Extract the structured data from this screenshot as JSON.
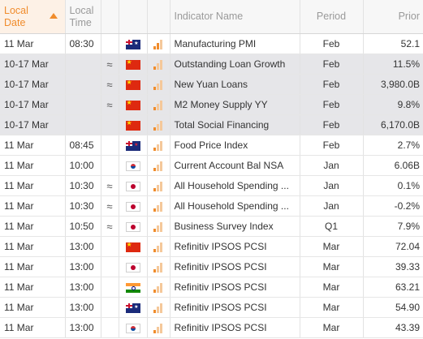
{
  "header": {
    "local_date": "Local Date",
    "local_time": "Local Time",
    "indicator_name": "Indicator Name",
    "period": "Period",
    "prior": "Prior"
  },
  "colors": {
    "accent": "#f08c2c",
    "shaded_row": "#e6e6e9"
  },
  "rows": [
    {
      "date": "11 Mar",
      "time": "08:30",
      "approx": "",
      "flag": "au",
      "importance": 2,
      "name": "Manufacturing PMI",
      "period": "Feb",
      "prior": "52.1",
      "shaded": false
    },
    {
      "date": "10-17 Mar",
      "time": "",
      "approx": "≈",
      "flag": "cn",
      "importance": 1,
      "name": "Outstanding Loan Growth",
      "period": "Feb",
      "prior": "11.5%",
      "shaded": true
    },
    {
      "date": "10-17 Mar",
      "time": "",
      "approx": "≈",
      "flag": "cn",
      "importance": 1,
      "name": "New Yuan Loans",
      "period": "Feb",
      "prior": "3,980.0B",
      "shaded": true
    },
    {
      "date": "10-17 Mar",
      "time": "",
      "approx": "≈",
      "flag": "cn",
      "importance": 1,
      "name": "M2 Money Supply YY",
      "period": "Feb",
      "prior": "9.8%",
      "shaded": true
    },
    {
      "date": "10-17 Mar",
      "time": "",
      "approx": "",
      "flag": "cn",
      "importance": 1,
      "name": "Total Social Financing",
      "period": "Feb",
      "prior": "6,170.0B",
      "shaded": true
    },
    {
      "date": "11 Mar",
      "time": "08:45",
      "approx": "",
      "flag": "nz",
      "importance": 1,
      "name": "Food Price Index",
      "period": "Feb",
      "prior": "2.7%",
      "shaded": false
    },
    {
      "date": "11 Mar",
      "time": "10:00",
      "approx": "",
      "flag": "kr",
      "importance": 1,
      "name": "Current Account Bal NSA",
      "period": "Jan",
      "prior": "6.06B",
      "shaded": false
    },
    {
      "date": "11 Mar",
      "time": "10:30",
      "approx": "≈",
      "flag": "jp",
      "importance": 1,
      "name": "All Household Spending ...",
      "period": "Jan",
      "prior": "0.1%",
      "shaded": false
    },
    {
      "date": "11 Mar",
      "time": "10:30",
      "approx": "≈",
      "flag": "jp",
      "importance": 1,
      "name": "All Household Spending ...",
      "period": "Jan",
      "prior": "-0.2%",
      "shaded": false
    },
    {
      "date": "11 Mar",
      "time": "10:50",
      "approx": "≈",
      "flag": "jp",
      "importance": 1,
      "name": "Business Survey Index",
      "period": "Q1",
      "prior": "7.9%",
      "shaded": false
    },
    {
      "date": "11 Mar",
      "time": "13:00",
      "approx": "",
      "flag": "cn",
      "importance": 1,
      "name": "Refinitiv IPSOS PCSI",
      "period": "Mar",
      "prior": "72.04",
      "shaded": false
    },
    {
      "date": "11 Mar",
      "time": "13:00",
      "approx": "",
      "flag": "jp",
      "importance": 1,
      "name": "Refinitiv IPSOS PCSI",
      "period": "Mar",
      "prior": "39.33",
      "shaded": false
    },
    {
      "date": "11 Mar",
      "time": "13:00",
      "approx": "",
      "flag": "in",
      "importance": 1,
      "name": "Refinitiv IPSOS PCSI",
      "period": "Mar",
      "prior": "63.21",
      "shaded": false
    },
    {
      "date": "11 Mar",
      "time": "13:00",
      "approx": "",
      "flag": "au",
      "importance": 1,
      "name": "Refinitiv IPSOS PCSI",
      "period": "Mar",
      "prior": "54.90",
      "shaded": false
    },
    {
      "date": "11 Mar",
      "time": "13:00",
      "approx": "",
      "flag": "kr",
      "importance": 1,
      "name": "Refinitiv IPSOS PCSI",
      "period": "Mar",
      "prior": "43.39",
      "shaded": false
    }
  ]
}
